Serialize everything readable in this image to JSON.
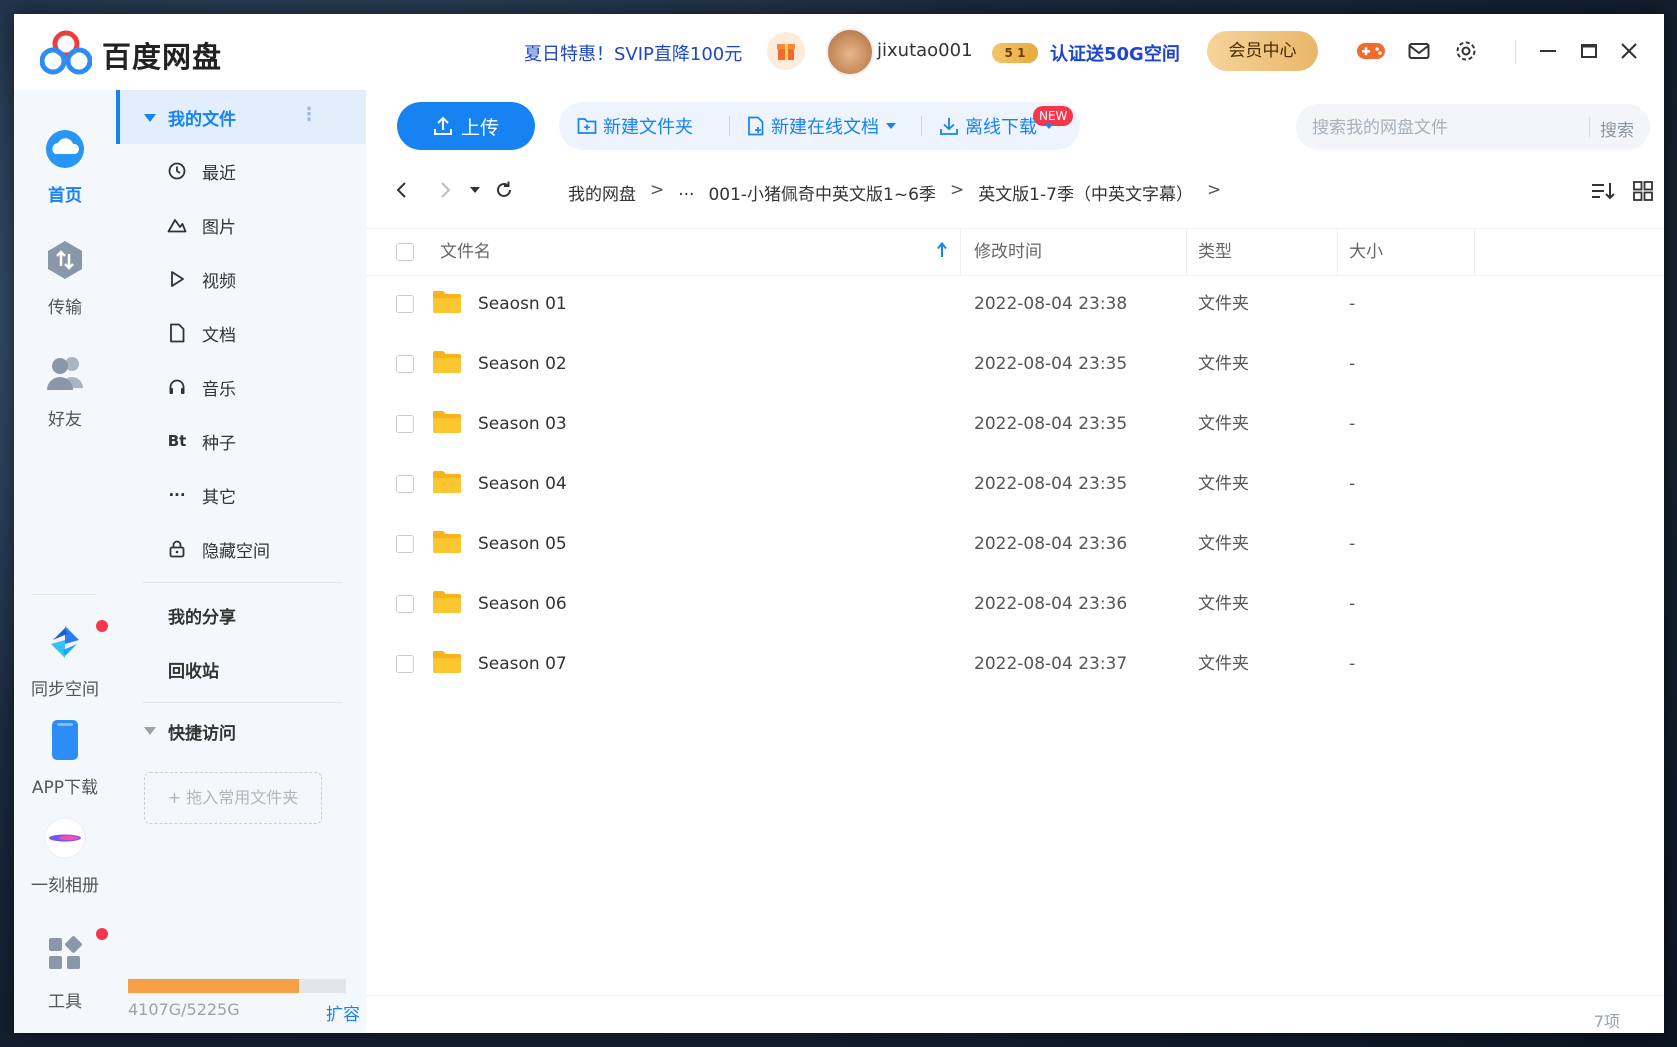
{
  "app": {
    "title": "百度网盘"
  },
  "header": {
    "promo": "夏日特惠！SVIP直降100元",
    "username": "jixutao001",
    "vip_badge": "5 1",
    "cert_link": "认证送50G空间",
    "member_center": "会员中心"
  },
  "rail": {
    "items": [
      {
        "label": "首页",
        "icon": "cloud-home-icon",
        "active": true
      },
      {
        "label": "传输",
        "icon": "transfer-icon"
      },
      {
        "label": "好友",
        "icon": "friends-icon"
      },
      {
        "label": "同步空间",
        "icon": "sync-space-icon"
      },
      {
        "label": "APP下载",
        "icon": "phone-icon"
      },
      {
        "label": "一刻相册",
        "icon": "album-icon"
      },
      {
        "label": "工具",
        "icon": "tools-icon"
      }
    ]
  },
  "sidebar": {
    "my_files": "我的文件",
    "categories": [
      {
        "label": "最近",
        "icon": "clock-icon"
      },
      {
        "label": "图片",
        "icon": "picture-icon"
      },
      {
        "label": "视频",
        "icon": "play-icon"
      },
      {
        "label": "文档",
        "icon": "document-icon"
      },
      {
        "label": "音乐",
        "icon": "headphones-icon"
      },
      {
        "label": "种子",
        "icon": "torrent-icon",
        "glyph": "Bt"
      },
      {
        "label": "其它",
        "icon": "more-icon",
        "glyph": "···"
      },
      {
        "label": "隐藏空间",
        "icon": "lock-icon"
      }
    ],
    "my_share": "我的分享",
    "recycle": "回收站",
    "quick_access": "快捷访问",
    "drop_hint": "+ 拖入常用文件夹",
    "quota_text": "4107G/5225G",
    "quota_used_fraction": 0.786,
    "expand": "扩容"
  },
  "toolbar": {
    "upload": "上传",
    "new_folder": "新建文件夹",
    "new_online_doc": "新建在线文档",
    "new_badge": "NEW",
    "offline_download": "离线下载",
    "search_placeholder": "搜索我的网盘文件",
    "search_button": "搜索"
  },
  "breadcrumb": [
    "我的网盘",
    "...",
    "001-小猪佩奇中英文版1~6季",
    "英文版1-7季（中英文字幕）"
  ],
  "table": {
    "columns": {
      "name": "文件名",
      "modified": "修改时间",
      "type": "类型",
      "size": "大小"
    },
    "rows": [
      {
        "name": "Seaosn 01",
        "modified": "2022-08-04 23:38",
        "type": "文件夹",
        "size": "-"
      },
      {
        "name": "Season 02",
        "modified": "2022-08-04 23:35",
        "type": "文件夹",
        "size": "-"
      },
      {
        "name": "Season 03",
        "modified": "2022-08-04 23:35",
        "type": "文件夹",
        "size": "-"
      },
      {
        "name": "Season 04",
        "modified": "2022-08-04 23:35",
        "type": "文件夹",
        "size": "-"
      },
      {
        "name": "Season 05",
        "modified": "2022-08-04 23:36",
        "type": "文件夹",
        "size": "-"
      },
      {
        "name": "Season 06",
        "modified": "2022-08-04 23:36",
        "type": "文件夹",
        "size": "-"
      },
      {
        "name": "Season 07",
        "modified": "2022-08-04 23:37",
        "type": "文件夹",
        "size": "-"
      }
    ]
  },
  "status": {
    "count": "7项"
  },
  "colors": {
    "accent": "#1783f2",
    "quota": "#f7a045",
    "folder": "#fcc631",
    "badge": "#f5364b"
  }
}
